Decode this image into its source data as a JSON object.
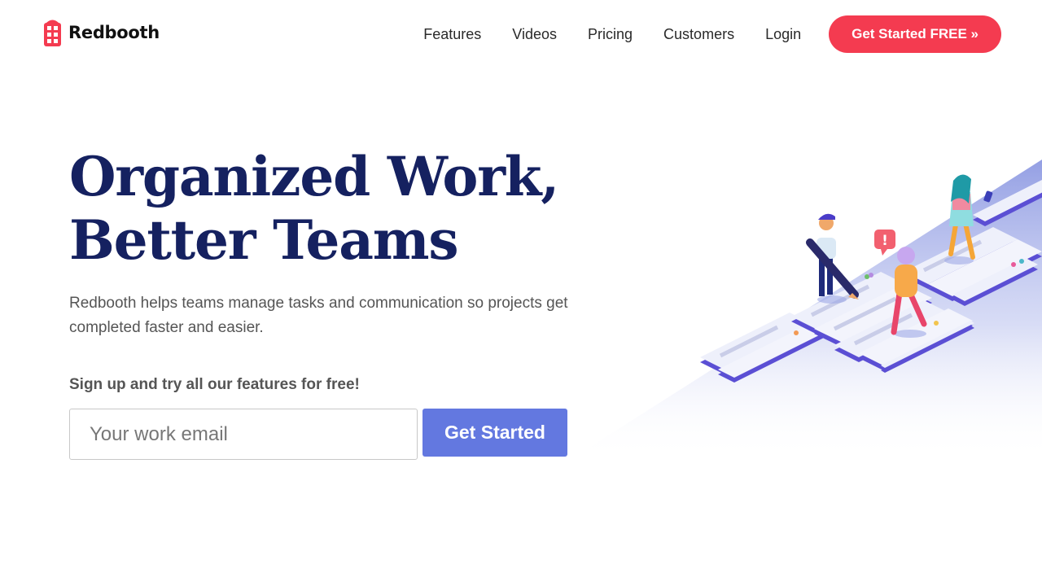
{
  "brand": {
    "name": "Redbooth",
    "accent": "#f43b50",
    "primary": "#152160",
    "button": "#6378e0"
  },
  "nav": {
    "items": [
      {
        "label": "Features"
      },
      {
        "label": "Videos"
      },
      {
        "label": "Pricing"
      },
      {
        "label": "Customers"
      },
      {
        "label": "Login"
      }
    ],
    "cta": "Get Started FREE »"
  },
  "hero": {
    "title_line1": "Organized Work,",
    "title_line2": "Better Teams",
    "subtitle": "Redbooth helps teams manage tasks and communication so projects get completed faster and easier.",
    "signup_label": "Sign up and try all our features for free!",
    "email_placeholder": "Your work email",
    "email_value": "",
    "submit_label": "Get Started"
  },
  "illustration": {
    "icon": "team-board-illustration",
    "alert_glyph": "!"
  }
}
